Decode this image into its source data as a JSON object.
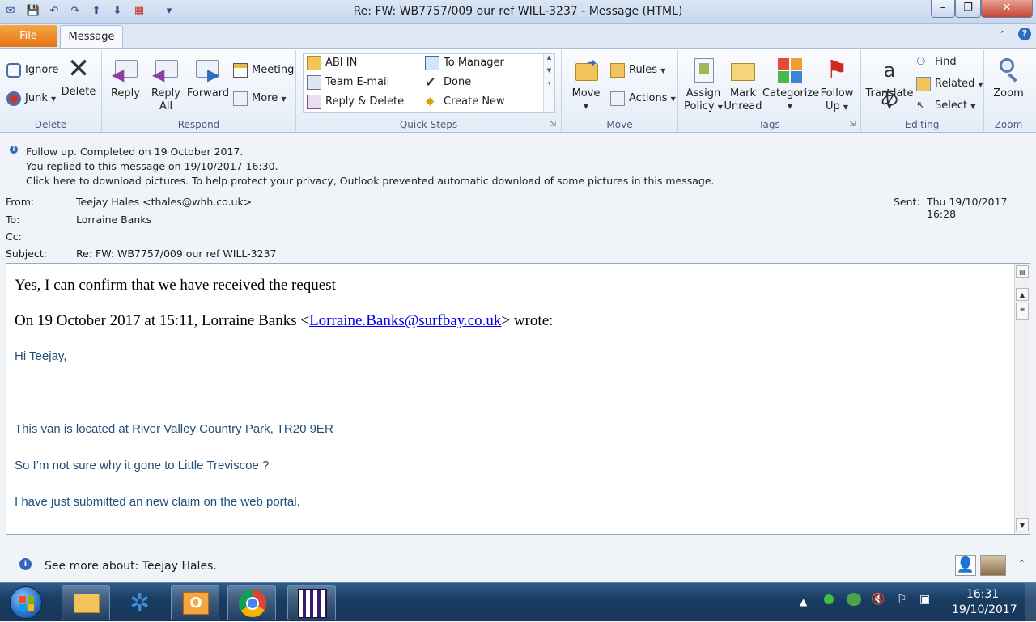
{
  "window": {
    "title": "Re: FW: WB7757/009 our ref WILL-3237  -  Message (HTML)",
    "minimize": "–",
    "maximize": "❐",
    "close": "✕"
  },
  "qat": {
    "save": "💾",
    "undo": "↶",
    "redo": "↷",
    "up": "⬆",
    "down": "⬇",
    "more": "▾"
  },
  "tabs": {
    "file": "File",
    "message": "Message"
  },
  "ribbon": {
    "delete_group": {
      "label": "Delete",
      "ignore": "Ignore",
      "junk": "Junk",
      "delete": "Delete"
    },
    "respond_group": {
      "label": "Respond",
      "reply": "Reply",
      "reply_all_1": "Reply",
      "reply_all_2": "All",
      "forward": "Forward",
      "meeting": "Meeting",
      "more": "More"
    },
    "quick_steps": {
      "label": "Quick Steps",
      "items": [
        "ABI IN",
        "Team E-mail",
        "Reply & Delete",
        "To Manager",
        "Done",
        "Create New"
      ]
    },
    "move_group": {
      "label": "Move",
      "move": "Move",
      "rules": "Rules",
      "actions": "Actions"
    },
    "tags_group": {
      "label": "Tags",
      "assign_1": "Assign",
      "assign_2": "Policy",
      "mark_1": "Mark",
      "mark_2": "Unread",
      "categorize": "Categorize",
      "follow_1": "Follow",
      "follow_2": "Up"
    },
    "editing_group": {
      "label": "Editing",
      "translate": "Translate",
      "find": "Find",
      "related": "Related",
      "select": "Select"
    },
    "zoom_group": {
      "label": "Zoom",
      "zoom": "Zoom"
    }
  },
  "infobar": {
    "line1": "Follow up.  Completed on 19 October 2017.",
    "line2": "You replied to this message on 19/10/2017 16:30.",
    "line3": "Click here to download pictures. To help protect your privacy, Outlook prevented automatic download of some pictures in this message."
  },
  "header": {
    "from_label": "From:",
    "from_value": "Teejay Hales <thales@whh.co.uk>",
    "to_label": "To:",
    "to_value": "Lorraine Banks",
    "cc_label": "Cc:",
    "cc_value": "",
    "subject_label": "Subject:",
    "subject_value": "Re: FW: WB7757/009 our ref WILL-3237",
    "sent_label": "Sent:",
    "sent_value": "Thu 19/10/2017 16:28"
  },
  "body": {
    "line1": "Yes, I can confirm that we have received the request",
    "quote_prefix": "On 19 October 2017 at 15:11, Lorraine Banks <",
    "quote_email": "Lorraine.Banks@surfbay.co.uk",
    "quote_suffix": "> wrote:",
    "greeting": "Hi Teejay,",
    "p1": "This van is located at River Valley Country Park, TR20 9ER",
    "p2": "So I’m not sure why it gone to Little Treviscoe ?",
    "p3": "I have just submitted an new claim on the web portal."
  },
  "people_pane": {
    "text": "See more about: Teejay Hales."
  },
  "taskbar": {
    "time": "16:31",
    "date": "19/10/2017"
  }
}
